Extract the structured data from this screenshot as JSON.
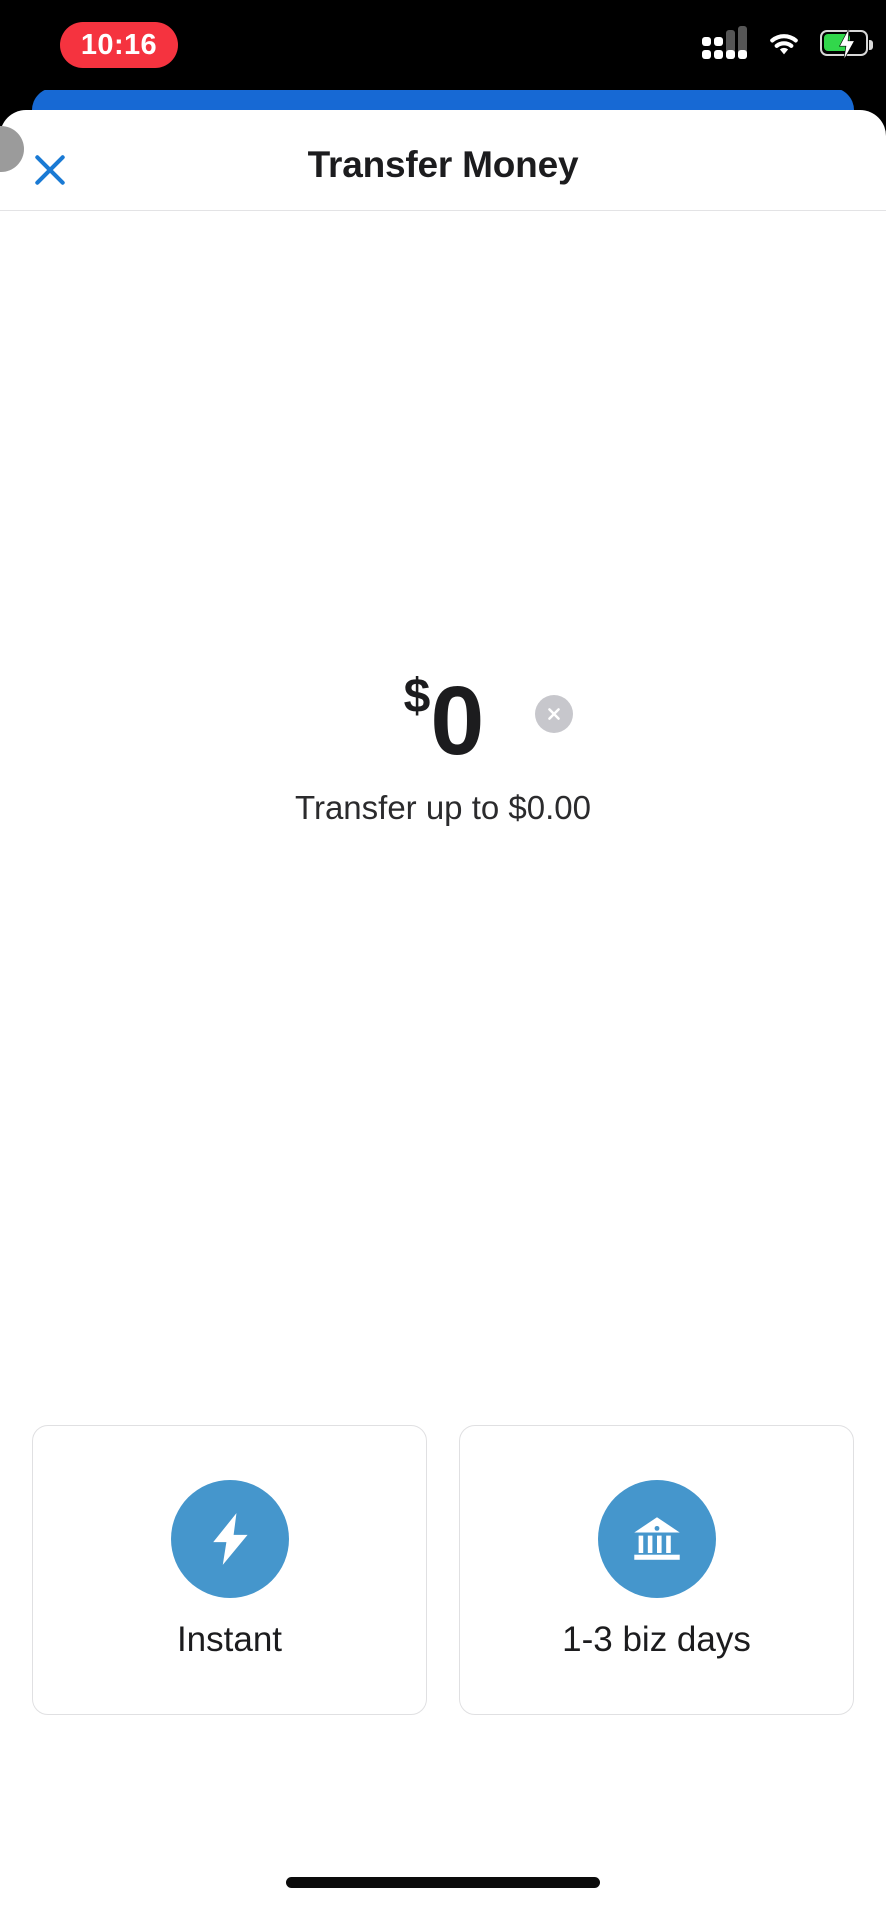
{
  "status_bar": {
    "time": "10:16",
    "time_pill_color": "#f5333f",
    "icons": [
      "cellular-signal-icon",
      "wifi-icon",
      "battery-charging-icon"
    ],
    "battery_color": "#31d74b"
  },
  "background_card": {
    "color": "#1769d4",
    "name": "stacked-card-behind"
  },
  "sheet": {
    "title": "Transfer Money",
    "close_label": "✕",
    "accent_color": "#1769d4"
  },
  "amount": {
    "currency_symbol": "$",
    "value": "0",
    "clear_label": "✕",
    "note": "Transfer up to $0.00"
  },
  "options": {
    "items": [
      {
        "label": "Instant",
        "icon": "lightning-bolt-icon"
      },
      {
        "label": "1-3 biz days",
        "icon": "bank-icon"
      }
    ],
    "icon_color": "#4596cc"
  }
}
